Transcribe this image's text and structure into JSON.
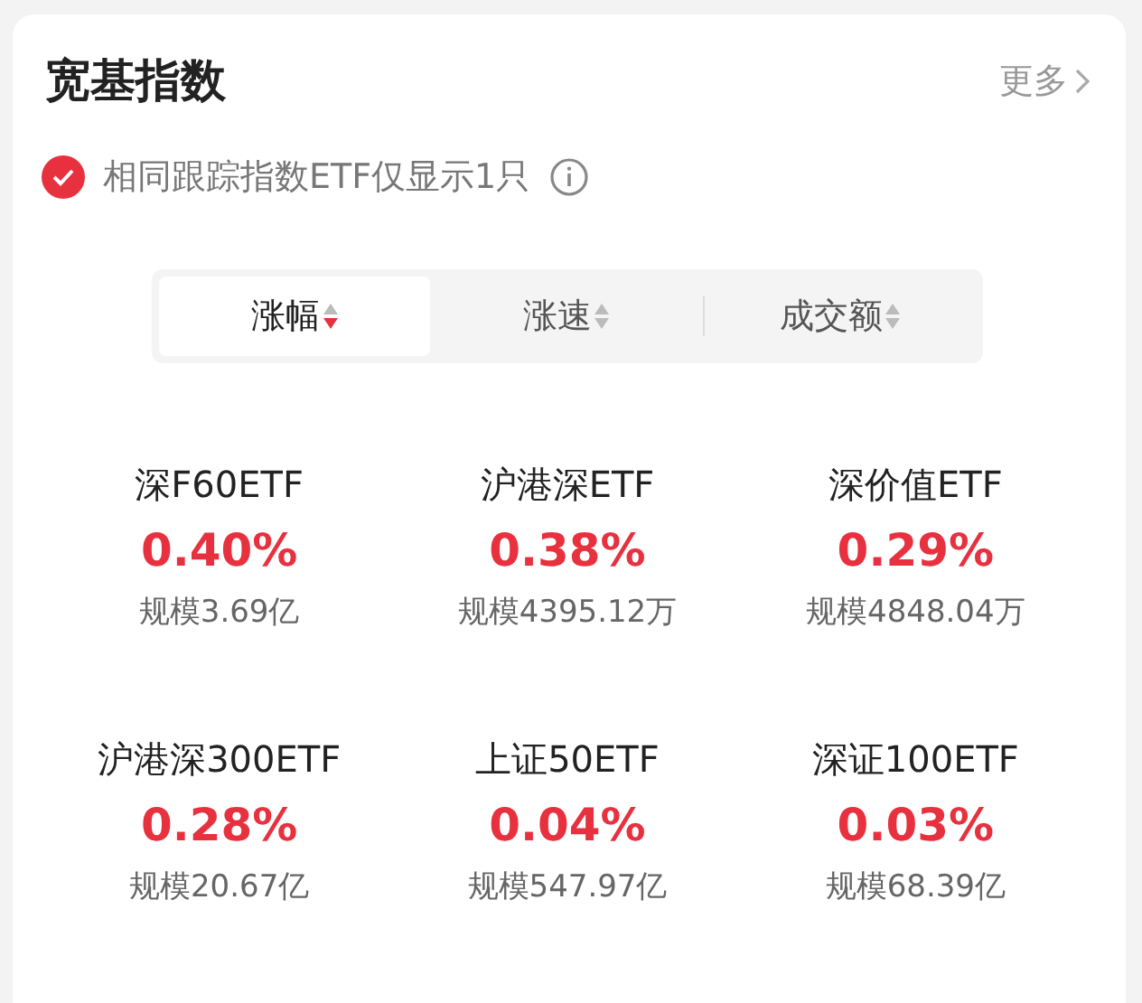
{
  "header": {
    "title": "宽基指数",
    "more": "更多"
  },
  "filter": {
    "label": "相同跟踪指数ETF仅显示1只",
    "checked": true
  },
  "sort_tabs": [
    {
      "label": "涨幅",
      "selected": true,
      "descending": true
    },
    {
      "label": "涨速",
      "selected": false,
      "descending": false
    },
    {
      "label": "成交额",
      "selected": false,
      "descending": false
    }
  ],
  "funds": [
    {
      "name": "深F60ETF",
      "change": "0.40%",
      "scale": "规模3.69亿"
    },
    {
      "name": "沪港深ETF",
      "change": "0.38%",
      "scale": "规模4395.12万"
    },
    {
      "name": "深价值ETF",
      "change": "0.29%",
      "scale": "规模4848.04万"
    },
    {
      "name": "沪港深300ETF",
      "change": "0.28%",
      "scale": "规模20.67亿"
    },
    {
      "name": "上证50ETF",
      "change": "0.04%",
      "scale": "规模547.97亿"
    },
    {
      "name": "深证100ETF",
      "change": "0.03%",
      "scale": "规模68.39亿"
    }
  ]
}
